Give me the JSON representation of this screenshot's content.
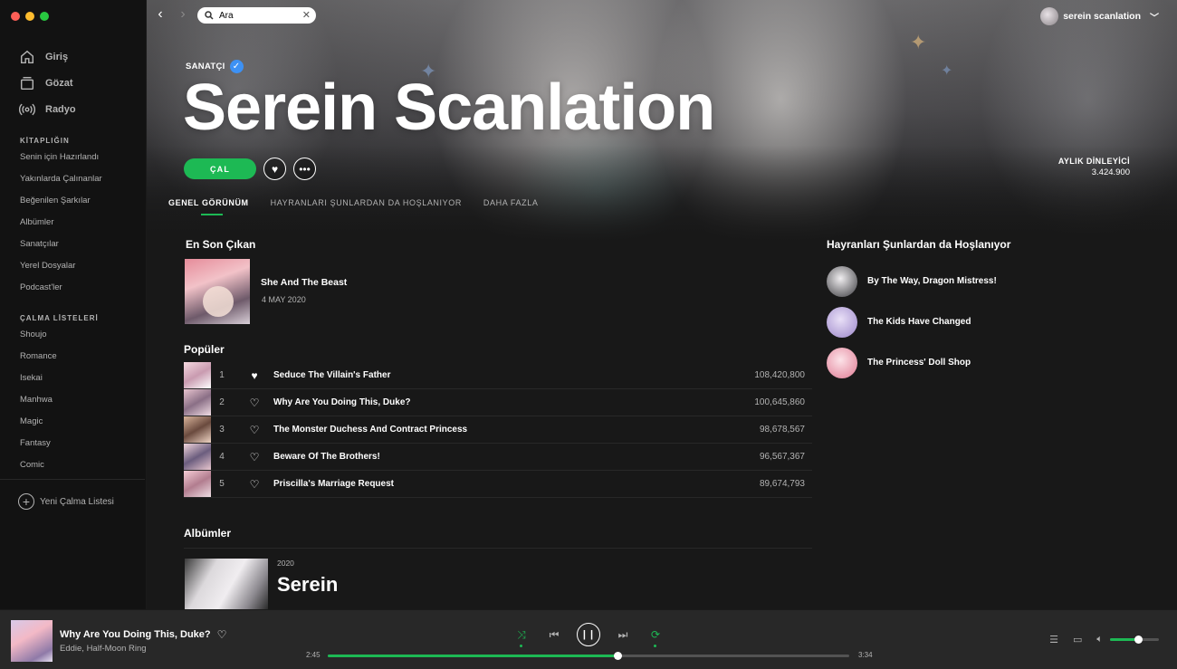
{
  "colors": {
    "accent": "#1db954",
    "verified": "#3d91f4",
    "sidebar_bg": "#121212",
    "main_bg": "#181818",
    "player_bg": "#282828"
  },
  "sidebar": {
    "nav": [
      {
        "label": "Giriş",
        "icon": "home-icon"
      },
      {
        "label": "Gözat",
        "icon": "browse-icon"
      },
      {
        "label": "Radyo",
        "icon": "radio-icon"
      }
    ],
    "library_title": "KİTAPLIĞIN",
    "library": [
      "Senin için Hazırlandı",
      "Yakınlarda Çalınanlar",
      "Beğenilen Şarkılar",
      "Albümler",
      "Sanatçılar",
      "Yerel Dosyalar",
      "Podcast'ler"
    ],
    "playlists_title": "ÇALMA LİSTELERİ",
    "playlists": [
      "Shoujo",
      "Romance",
      "Isekai",
      "Manhwa",
      "Magic",
      "Fantasy",
      "Comic"
    ],
    "new_playlist": "Yeni Çalma Listesi"
  },
  "topbar": {
    "search_value": "Ara",
    "user_name": "serein scanlation"
  },
  "artist": {
    "label": "SANATÇI",
    "name": "Serein Scanlation",
    "play_label": "ÇAL",
    "monthly_label": "AYLIK DİNLEYİCİ",
    "monthly_value": "3.424.900"
  },
  "tabs": [
    "GENEL GÖRÜNÜM",
    "HAYRANLARI ŞUNLARDAN DA HOŞLANIYOR",
    "DAHA FAZLA"
  ],
  "latest": {
    "heading": "En Son Çıkan",
    "title": "She And The Beast",
    "date": "4 MAY 2020"
  },
  "popular": {
    "heading": "Popüler",
    "tracks": [
      {
        "num": "1",
        "title": "Seduce The Villain's Father",
        "plays": "108,420,800",
        "liked": true
      },
      {
        "num": "2",
        "title": "Why Are You Doing This, Duke?",
        "plays": "100,645,860",
        "liked": false
      },
      {
        "num": "3",
        "title": "The Monster Duchess And Contract Princess",
        "plays": "98,678,567",
        "liked": false
      },
      {
        "num": "4",
        "title": "Beware Of The Brothers!",
        "plays": "96,567,367",
        "liked": false
      },
      {
        "num": "5",
        "title": "Priscilla's Marriage Request",
        "plays": "89,674,793",
        "liked": false
      }
    ]
  },
  "albums": {
    "heading": "Albümler",
    "items": [
      {
        "year": "2020",
        "title": "Serein"
      }
    ]
  },
  "fans": {
    "heading": "Hayranları Şunlardan da Hoşlanıyor",
    "items": [
      {
        "name": "By The Way, Dragon Mistress!"
      },
      {
        "name": "The Kids Have Changed"
      },
      {
        "name": "The Princess' Doll Shop"
      }
    ]
  },
  "player": {
    "title": "Why Are You Doing This, Duke?",
    "artist": "Eddie, Half-Moon Ring",
    "elapsed": "2:45",
    "duration": "3:34",
    "progress_fraction": 0.556,
    "volume_fraction": 0.58
  }
}
